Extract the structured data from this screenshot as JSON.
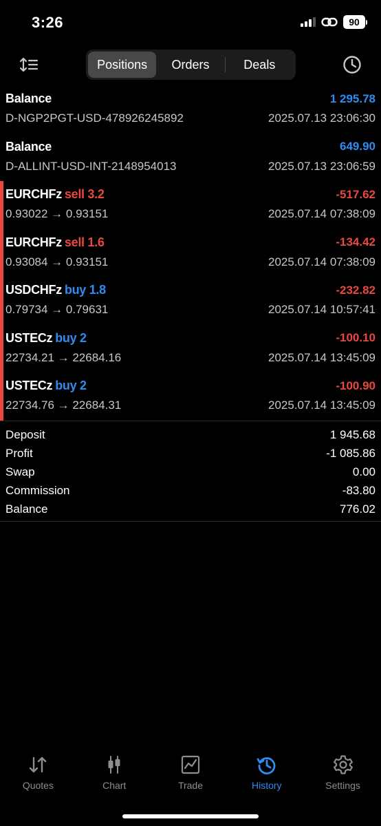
{
  "status": {
    "time": "3:26",
    "battery": "90"
  },
  "toolbar": {
    "tabs": [
      "Positions",
      "Orders",
      "Deals"
    ],
    "active_tab": "Positions"
  },
  "rows": [
    {
      "title": "Balance",
      "side": "",
      "side_type": "",
      "amount": "1 295.78",
      "amount_type": "pos",
      "detail": "D-NGP2PGT-USD-478926245892",
      "time": "2025.07.13 23:06:30"
    },
    {
      "title": "Balance",
      "side": "",
      "side_type": "",
      "amount": "649.90",
      "amount_type": "pos",
      "detail": "D-ALLINT-USD-INT-2148954013",
      "time": "2025.07.13 23:06:59"
    },
    {
      "title": "EURCHFz",
      "side": "sell 3.2",
      "side_type": "sell",
      "amount": "-517.62",
      "amount_type": "neg",
      "detail": "0.93022 → 0.93151",
      "time": "2025.07.14 07:38:09"
    },
    {
      "title": "EURCHFz",
      "side": "sell 1.6",
      "side_type": "sell",
      "amount": "-134.42",
      "amount_type": "neg",
      "detail": "0.93084 → 0.93151",
      "time": "2025.07.14 07:38:09"
    },
    {
      "title": "USDCHFz",
      "side": "buy 1.8",
      "side_type": "buy",
      "amount": "-232.82",
      "amount_type": "neg",
      "detail": "0.79734 → 0.79631",
      "time": "2025.07.14 10:57:41"
    },
    {
      "title": "USTECz",
      "side": "buy 2",
      "side_type": "buy",
      "amount": "-100.10",
      "amount_type": "neg",
      "detail": "22734.21 → 22684.16",
      "time": "2025.07.14 13:45:09"
    },
    {
      "title": "USTECz",
      "side": "buy 2",
      "side_type": "buy",
      "amount": "-100.90",
      "amount_type": "neg",
      "detail": "22734.76 → 22684.31",
      "time": "2025.07.14 13:45:09"
    }
  ],
  "summary": [
    {
      "label": "Deposit",
      "value": "1 945.68"
    },
    {
      "label": "Profit",
      "value": "-1 085.86"
    },
    {
      "label": "Swap",
      "value": "0.00"
    },
    {
      "label": "Commission",
      "value": "-83.80"
    },
    {
      "label": "Balance",
      "value": "776.02"
    }
  ],
  "tabbar": [
    {
      "label": "Quotes",
      "icon": "quotes-icon"
    },
    {
      "label": "Chart",
      "icon": "chart-icon"
    },
    {
      "label": "Trade",
      "icon": "trade-icon"
    },
    {
      "label": "History",
      "icon": "history-icon",
      "active": true
    },
    {
      "label": "Settings",
      "icon": "settings-icon"
    }
  ],
  "colors": {
    "accent": "#2f8cf0",
    "loss": "#e8483f",
    "background": "#000000"
  }
}
